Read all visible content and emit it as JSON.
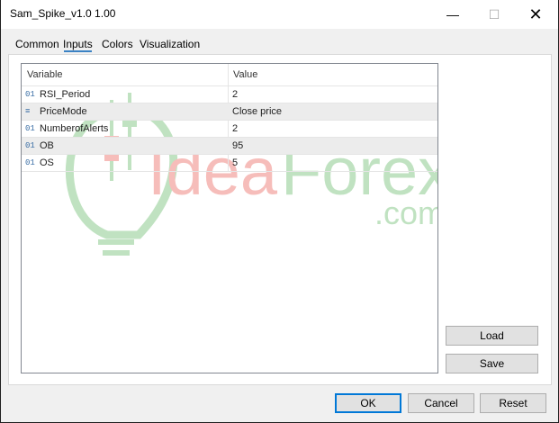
{
  "window": {
    "title": "Sam_Spike_v1.0 1.00"
  },
  "titlebar": {
    "minimize": "—",
    "maximize": "☐",
    "close": "✕"
  },
  "tabs": [
    {
      "label": "Common"
    },
    {
      "label": "Inputs",
      "active": true
    },
    {
      "label": "Colors"
    },
    {
      "label": "Visualization"
    }
  ],
  "table": {
    "headers": {
      "variable": "Variable",
      "value": "Value"
    },
    "rows": [
      {
        "type_icon": "01",
        "variable": "RSI_Period",
        "value": "2"
      },
      {
        "type_icon": "≡",
        "variable": "PriceMode",
        "value": "Close price"
      },
      {
        "type_icon": "01",
        "variable": "NumberofAlerts",
        "value": "2"
      },
      {
        "type_icon": "01",
        "variable": "OB",
        "value": "95"
      },
      {
        "type_icon": "01",
        "variable": "OS",
        "value": "5"
      }
    ]
  },
  "watermark": {
    "brand": "IdeaForex",
    "suffix": ".com",
    "brand_red": "#e8453c",
    "brand_green": "#4caf50"
  },
  "side_buttons": {
    "load": "Load",
    "save": "Save"
  },
  "footer_buttons": {
    "ok": "OK",
    "cancel": "Cancel",
    "reset": "Reset"
  },
  "colors": {
    "accent": "#0078d7"
  }
}
